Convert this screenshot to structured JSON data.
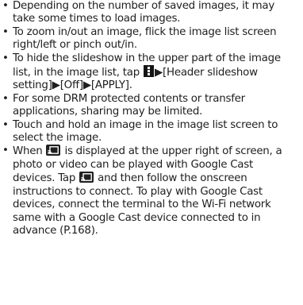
{
  "notes": [
    {
      "text": "Depending on the number of saved images, it may take some times to load images."
    },
    {
      "text": "To zoom in/out an image, flick the image list screen right/left or pinch out/in."
    },
    {
      "pre": "To hide the slideshow in the upper part of the image list, in the image list, tap ",
      "icon": "menu-dots-icon",
      "post": "▶[Header slideshow setting]▶[Off]▶[APPLY]."
    },
    {
      "text": "For some DRM protected contents or transfer applications, sharing may be limited."
    },
    {
      "text": "Touch and hold an image in the image list screen to select the image."
    },
    {
      "pre": "When ",
      "icon": "cast-icon",
      "mid": " is displayed at the upper right of screen, a photo or video can be played with Google Cast devices. Tap ",
      "icon2": "cast-icon",
      "post": " and then follow the onscreen instructions to connect. To play with Google Cast devices, connect the terminal to the Wi-Fi network same with a Google Cast device connected to in advance (P.168)."
    }
  ],
  "bullet_char": "•"
}
